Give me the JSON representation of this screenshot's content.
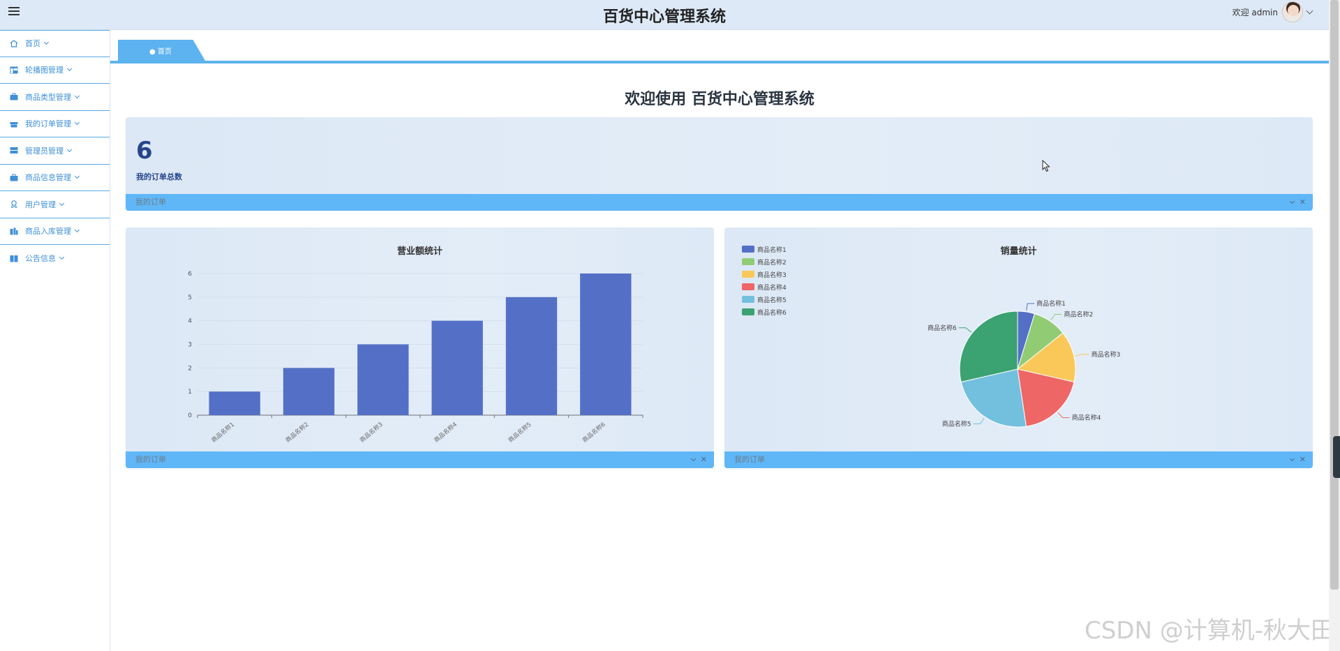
{
  "header": {
    "title": "百货中心管理系统",
    "user_greeting": "欢迎 admin"
  },
  "sidebar": {
    "items": [
      {
        "label": "首页",
        "icon": "home-icon"
      },
      {
        "label": "轮播图管理",
        "icon": "layout-icon"
      },
      {
        "label": "商品类型管理",
        "icon": "briefcase-icon"
      },
      {
        "label": "我的订单管理",
        "icon": "gift-icon"
      },
      {
        "label": "管理员管理",
        "icon": "server-icon"
      },
      {
        "label": "商品信息管理",
        "icon": "briefcase-icon"
      },
      {
        "label": "用户管理",
        "icon": "badge-icon"
      },
      {
        "label": "商品入库管理",
        "icon": "building-icon"
      },
      {
        "label": "公告信息",
        "icon": "book-icon"
      }
    ]
  },
  "tabs": [
    {
      "label": "● 首页"
    }
  ],
  "main": {
    "welcome": "欢迎使用 百货中心管理系统",
    "stat_card": {
      "value": "6",
      "label": "我的订单总数",
      "footer": "我的订单"
    },
    "bar_card": {
      "title": "营业额统计",
      "footer": "我的订单"
    },
    "pie_card": {
      "title": "销量统计",
      "footer": "我的订单"
    }
  },
  "watermark": "CSDN @计算机-秋大田",
  "colors": {
    "accent": "#5db3ef",
    "bar": "#5470c6"
  },
  "chart_data": [
    {
      "type": "bar",
      "title": "营业额统计",
      "categories": [
        "商品名称1",
        "商品名称2",
        "商品名称3",
        "商品名称4",
        "商品名称5",
        "商品名称6"
      ],
      "values": [
        1,
        2,
        3,
        4,
        5,
        6
      ],
      "ylim": [
        0,
        6
      ],
      "yticks": [
        0,
        1,
        2,
        3,
        4,
        5,
        6
      ],
      "grid": true
    },
    {
      "type": "pie",
      "title": "销量统计",
      "legend_position": "top-left",
      "labels": [
        "商品名称1",
        "商品名称2",
        "商品名称3",
        "商品名称4",
        "商品名称5",
        "商品名称6"
      ],
      "values": [
        1,
        2,
        3,
        4,
        5,
        6
      ],
      "colors": [
        "#5470c6",
        "#91cc75",
        "#fac858",
        "#ee6666",
        "#73c0de",
        "#3ba272"
      ]
    }
  ]
}
